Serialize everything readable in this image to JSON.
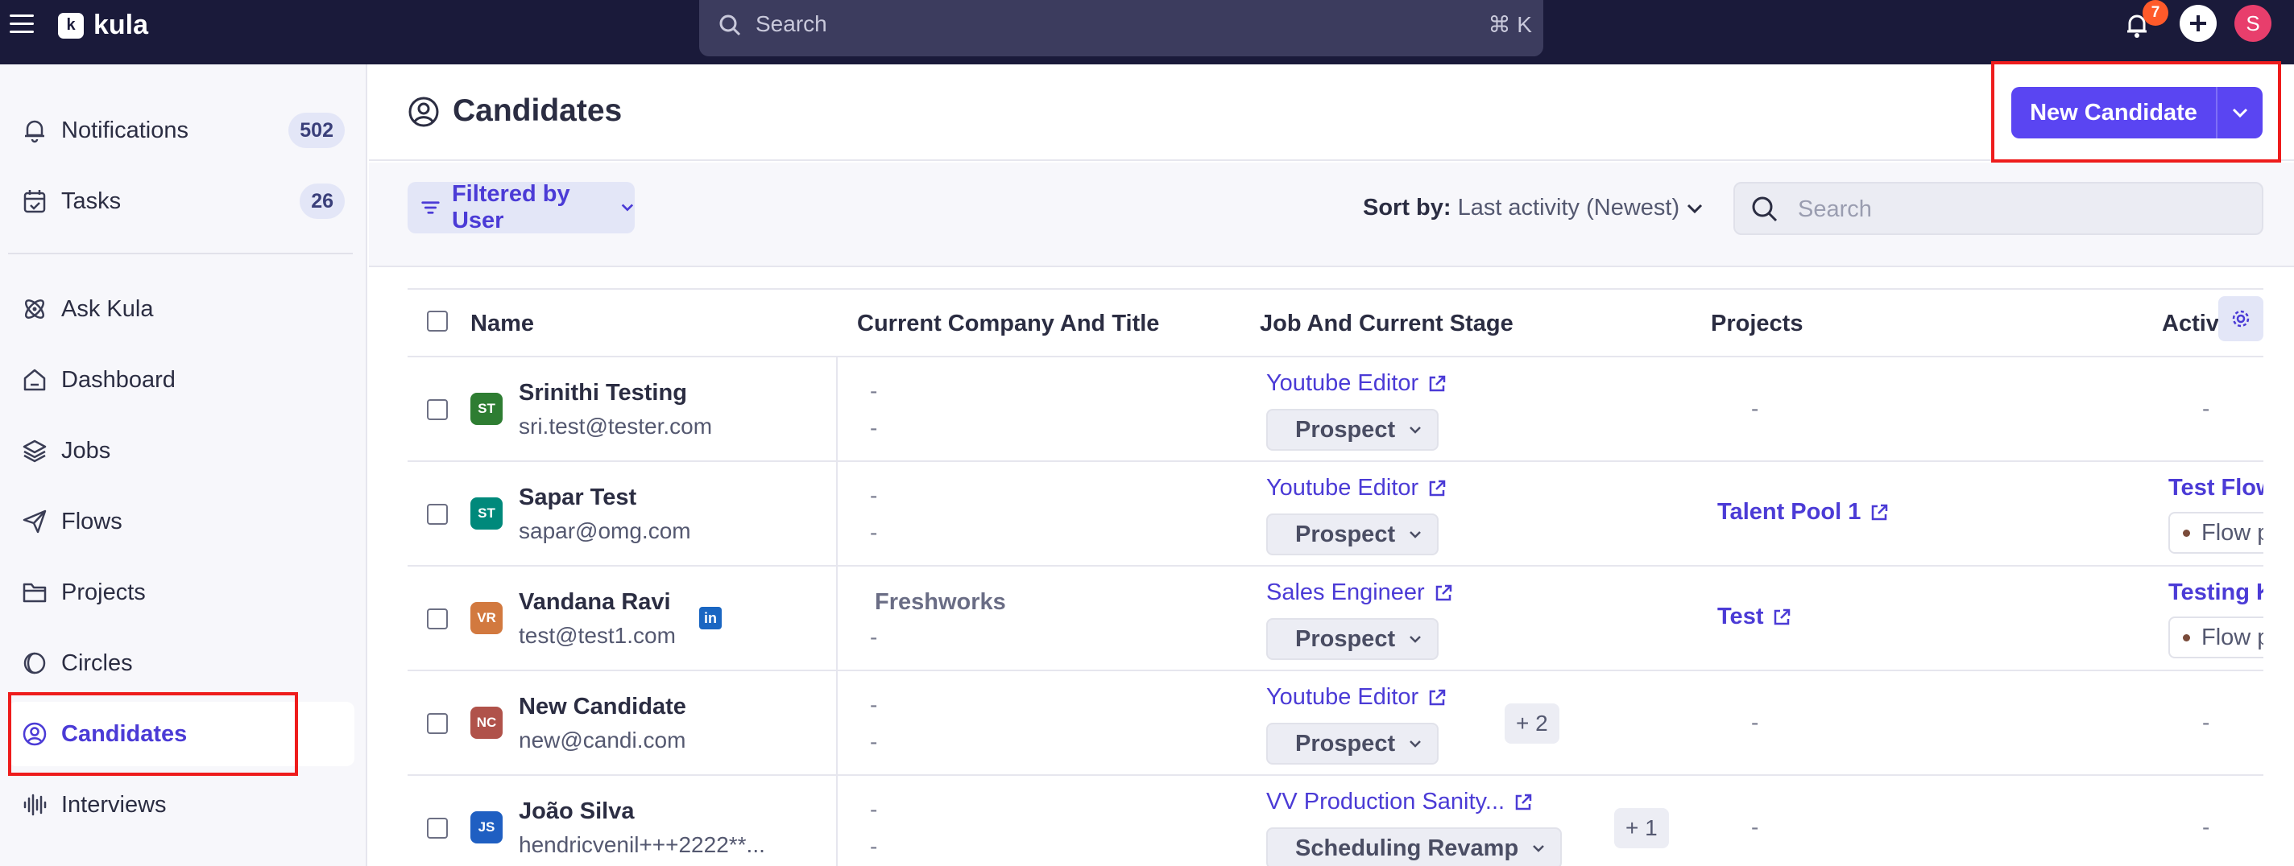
{
  "topbar": {
    "logo_text": "kula",
    "logo_mark": "k",
    "search_placeholder": "Search",
    "search_shortcut": "⌘ K",
    "notification_count": "7",
    "user_initial": "S"
  },
  "sidebar": {
    "items": [
      {
        "label": "Notifications",
        "icon": "bell-icon",
        "count": "502"
      },
      {
        "label": "Tasks",
        "icon": "calendar-check-icon",
        "count": "26"
      },
      {
        "label": "Ask Kula",
        "icon": "atom-icon"
      },
      {
        "label": "Dashboard",
        "icon": "home-icon"
      },
      {
        "label": "Jobs",
        "icon": "layers-icon"
      },
      {
        "label": "Flows",
        "icon": "send-icon"
      },
      {
        "label": "Projects",
        "icon": "folder-icon"
      },
      {
        "label": "Circles",
        "icon": "circles-icon"
      },
      {
        "label": "Candidates",
        "icon": "user-circle-icon",
        "active": true
      },
      {
        "label": "Interviews",
        "icon": "waveform-icon"
      }
    ]
  },
  "page": {
    "title": "Candidates",
    "new_button": "New Candidate",
    "filter_label": "Filtered by User",
    "sort_key": "Sort by:",
    "sort_value": "Last activity (Newest)",
    "search_placeholder": "Search"
  },
  "table": {
    "columns": [
      "Name",
      "Current Company And Title",
      "Job And Current Stage",
      "Projects",
      "Activity"
    ],
    "rows": [
      {
        "initials": "ST",
        "avatar_color": "#2e7d32",
        "name": "Srinithi Testing",
        "email": "sri.test@tester.com",
        "company": "-",
        "title": "-",
        "job": "Youtube Editor",
        "stage": "Prospect",
        "more": "",
        "project": "-",
        "activity": "-",
        "flow": ""
      },
      {
        "initials": "ST",
        "avatar_color": "#00897b",
        "name": "Sapar Test",
        "email": "sapar@omg.com",
        "company": "-",
        "title": "-",
        "job": "Youtube Editor",
        "stage": "Prospect",
        "more": "",
        "project": "Talent Pool 1",
        "activity": "Test Flow",
        "flow": "Flow p"
      },
      {
        "initials": "VR",
        "avatar_color": "#d2793f",
        "name": "Vandana Ravi",
        "email": "test@test1.com",
        "company": "Freshworks",
        "title": "-",
        "job": "Sales Engineer",
        "stage": "Prospect",
        "more": "",
        "project": "Test",
        "activity": "Testing K",
        "flow": "Flow p",
        "linkedin": "in"
      },
      {
        "initials": "NC",
        "avatar_color": "#b0524a",
        "name": "New Candidate",
        "email": "new@candi.com",
        "company": "-",
        "title": "-",
        "job": "Youtube Editor",
        "stage": "Prospect",
        "more": "+ 2",
        "project": "-",
        "activity": "-",
        "flow": ""
      },
      {
        "initials": "JS",
        "avatar_color": "#1f5fc2",
        "name": "João Silva",
        "email": "hendricvenil+++2222**...",
        "company": "-",
        "title": "-",
        "job": "VV Production Sanity...",
        "stage": "Scheduling Revamp",
        "more": "+ 1",
        "project": "-",
        "activity": "-",
        "flow": ""
      }
    ]
  },
  "colors": {
    "accent": "#5a45f2",
    "topbar": "#1a1a3a",
    "highlight": "#ee1c1c"
  }
}
